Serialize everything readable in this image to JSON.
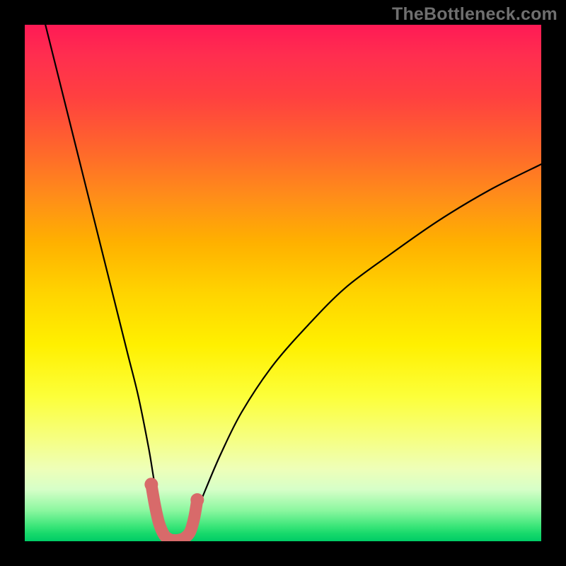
{
  "watermark": {
    "text": "TheBottleneck.com"
  },
  "chart_data": {
    "type": "line",
    "title": "",
    "xlabel": "",
    "ylabel": "",
    "xlim": [
      0,
      100
    ],
    "ylim": [
      0,
      100
    ],
    "grid": false,
    "legend": false,
    "series": [
      {
        "name": "bottleneck-curve",
        "color": "#000000",
        "x": [
          4,
          6,
          8,
          10,
          12,
          14,
          16,
          18,
          20,
          22,
          24,
          25,
          26,
          27,
          28,
          29,
          30,
          31,
          32,
          33,
          35,
          38,
          42,
          48,
          55,
          62,
          70,
          80,
          90,
          100
        ],
        "y": [
          100,
          92,
          84,
          76,
          68,
          60,
          52,
          44,
          36,
          28,
          18,
          12,
          7,
          3,
          1,
          0.5,
          0.5,
          1,
          2.5,
          5,
          10,
          17,
          25,
          34,
          42,
          49,
          55,
          62,
          68,
          73
        ]
      }
    ],
    "highlight": {
      "name": "near-optimal-band",
      "color": "#d86a6a",
      "x": [
        24.5,
        25.2,
        26.0,
        27.0,
        28.0,
        29.0,
        30.0,
        31.0,
        32.0,
        32.8,
        33.4
      ],
      "y": [
        11.0,
        7.0,
        3.5,
        1.2,
        0.4,
        0.2,
        0.3,
        0.7,
        1.8,
        4.5,
        8.0
      ]
    },
    "gradient_bands": [
      {
        "color": "#ff1a55",
        "stop": 0
      },
      {
        "color": "#ff4040",
        "stop": 14
      },
      {
        "color": "#ff8c1a",
        "stop": 33
      },
      {
        "color": "#ffd400",
        "stop": 52
      },
      {
        "color": "#fcff3a",
        "stop": 72
      },
      {
        "color": "#eeffb8",
        "stop": 86
      },
      {
        "color": "#3de67a",
        "stop": 97
      },
      {
        "color": "#00cc66",
        "stop": 100
      }
    ]
  }
}
